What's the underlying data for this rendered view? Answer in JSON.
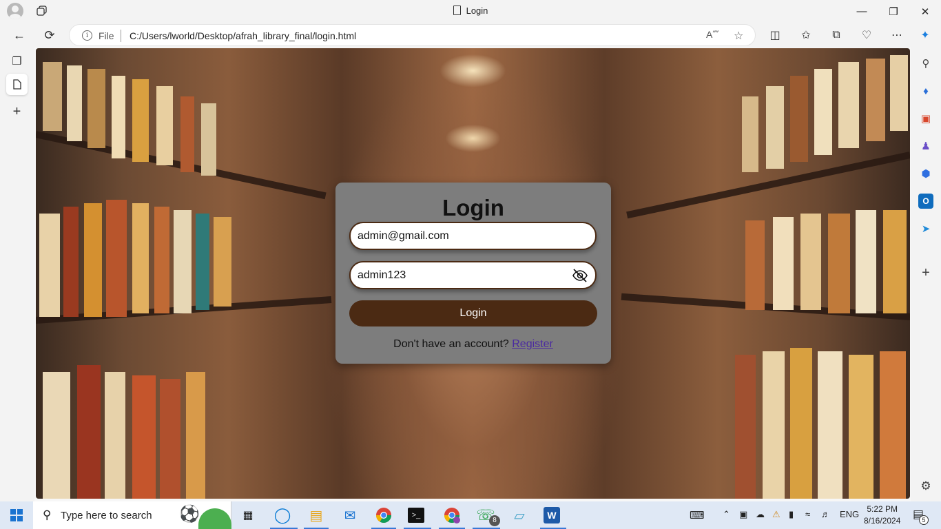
{
  "browser": {
    "tab_title": "Login",
    "address": {
      "scheme_label": "File",
      "url": "C:/Users/lworld/Desktop/afrah_library_final/login.html"
    }
  },
  "login": {
    "heading": "Login",
    "email_value": "admin@gmail.com",
    "password_value": "admin123",
    "submit_label": "Login",
    "register_prompt": "Don't have an account?",
    "register_link": "Register"
  },
  "taskbar": {
    "search_placeholder": "Type here to search",
    "language": "ENG",
    "time": "5:22 PM",
    "date": "8/16/2024",
    "whatsapp_badge": "8",
    "notification_count": "5"
  },
  "colors": {
    "card_bg": "#7d7d7d",
    "accent_brown": "#4b2a13",
    "link": "#4b2aa0"
  }
}
